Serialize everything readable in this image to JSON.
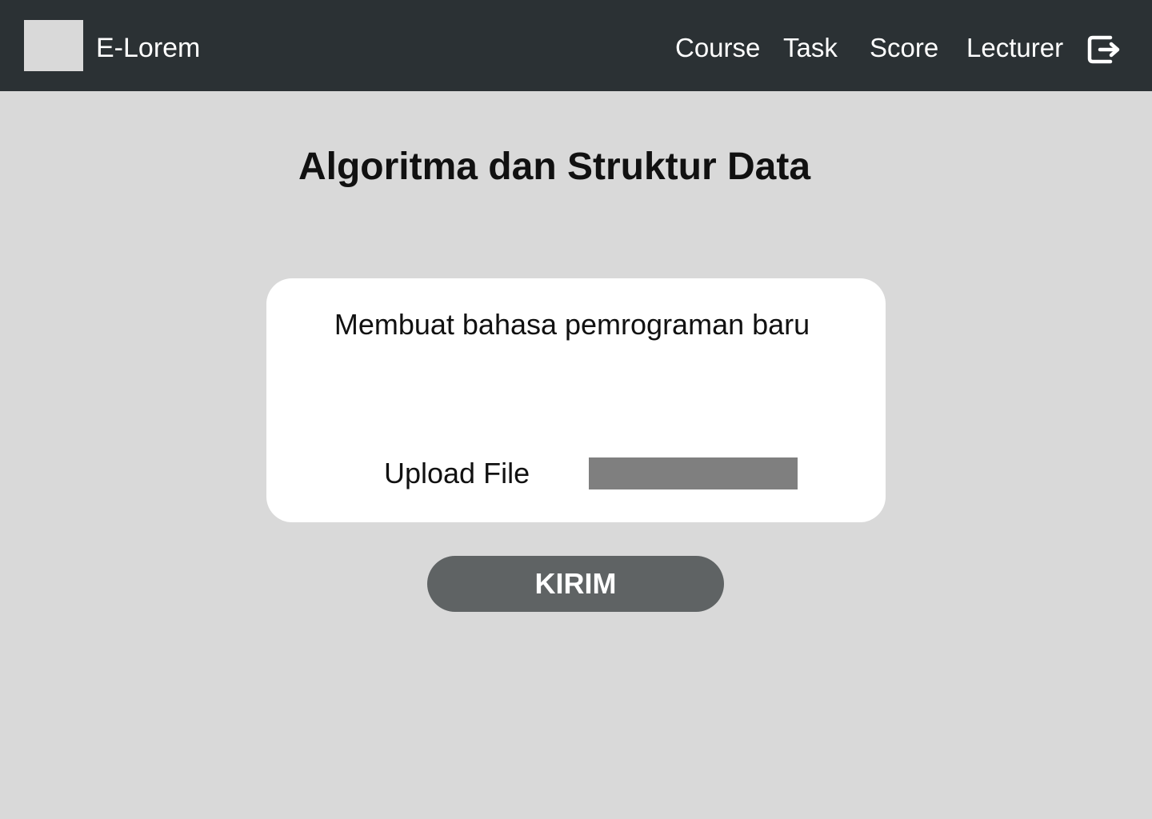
{
  "header": {
    "logo_icon": "logo-placeholder",
    "brand": "E-Lorem",
    "nav": {
      "course": "Course",
      "task": "Task",
      "score": "Score",
      "lecturer": "Lecturer"
    },
    "logout_icon": "logout-icon"
  },
  "main": {
    "title": "Algoritma dan Struktur Data",
    "task_card": {
      "task_name": "Membuat bahasa pemrograman baru",
      "upload_label": "Upload File"
    },
    "submit_label": "KIRIM"
  },
  "colors": {
    "navbar": "#2b3134",
    "background": "#d9d9d9",
    "card": "#ffffff",
    "upload_field": "#7f7f7f",
    "button": "#5f6364"
  }
}
